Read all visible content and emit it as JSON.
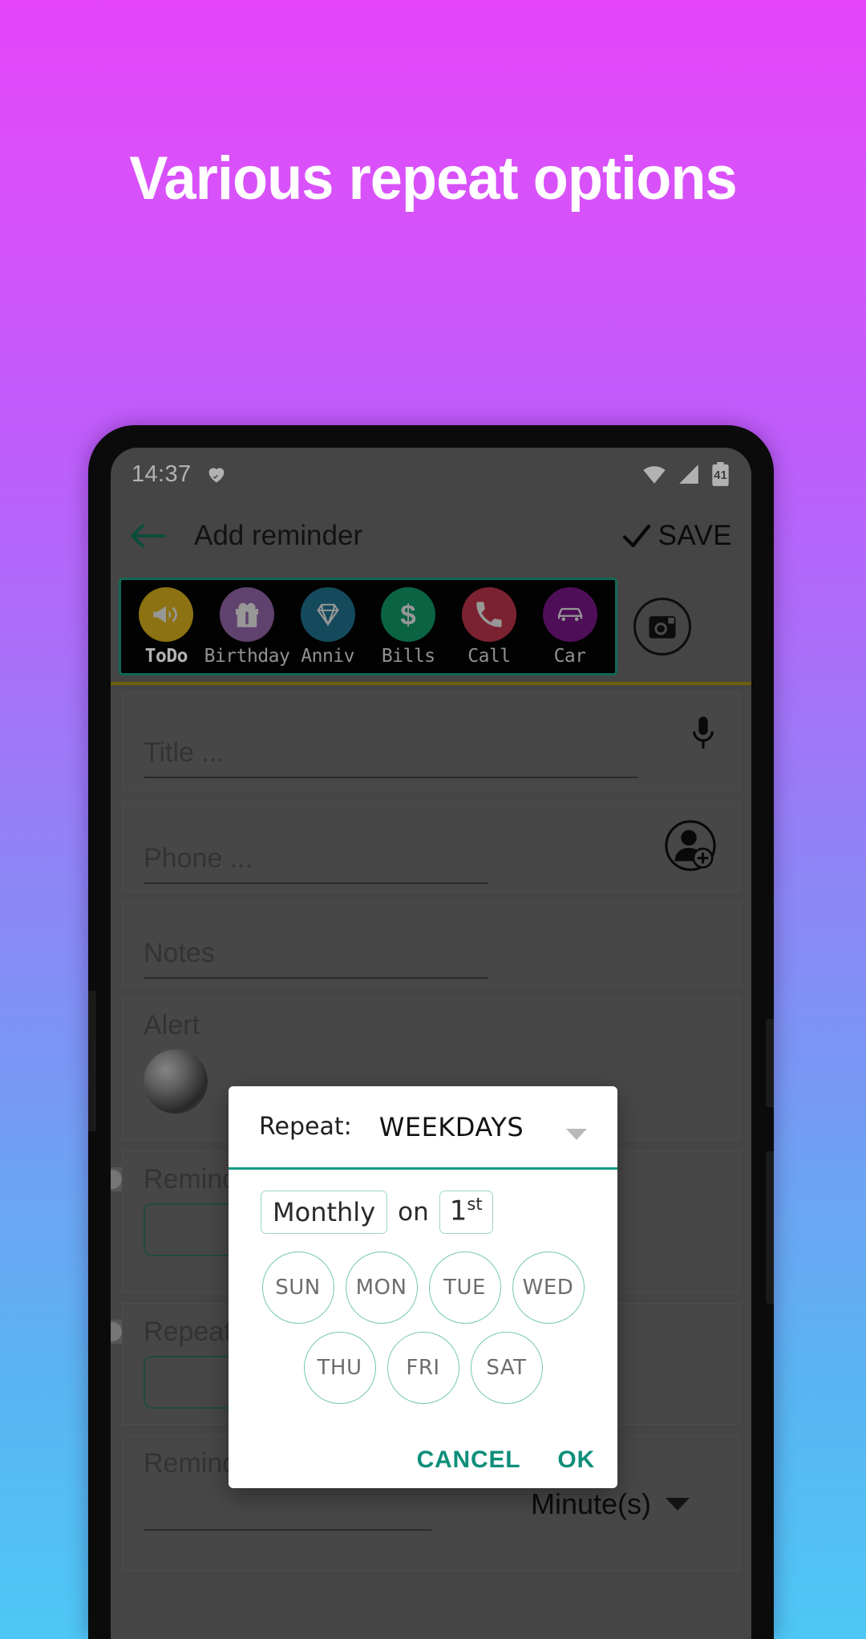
{
  "promo": {
    "headline": "Various repeat options",
    "background_gradient_from": "#e344f8",
    "background_gradient_to": "#4ec7f6"
  },
  "statusbar": {
    "time": "14:37",
    "heart_icon": "heart-check-icon",
    "wifi_icon": "wifi-icon",
    "signal_icon": "cell-signal-icon",
    "battery_icon": "battery-icon",
    "battery_level": "41"
  },
  "appbar": {
    "back_icon": "back-arrow-icon",
    "title": "Add reminder",
    "save_check_icon": "check-icon",
    "save_label": "SAVE",
    "accent_color": "#0f7a63"
  },
  "categories": {
    "camera_icon": "camera-icon",
    "items": [
      {
        "label": "ToDo",
        "icon": "megaphone-icon",
        "color": "#c9a41b",
        "selected": true
      },
      {
        "label": "Birthday",
        "icon": "gift-icon",
        "color": "#8a5f9e",
        "selected": false
      },
      {
        "label": "Anniv",
        "icon": "diamond-icon",
        "color": "#1f6b85",
        "selected": false
      },
      {
        "label": "Bills",
        "icon": "dollar-icon",
        "color": "#0f8e5f",
        "selected": false
      },
      {
        "label": "Call",
        "icon": "phone-icon",
        "color": "#b03246",
        "selected": false
      },
      {
        "label": "Car",
        "icon": "car-icon",
        "color": "#72157f",
        "selected": false
      }
    ]
  },
  "form": {
    "title_placeholder": "Title ...",
    "title_mic_icon": "microphone-icon",
    "phone_placeholder": "Phone ...",
    "phone_contact_icon": "add-contact-icon",
    "notes_placeholder": "Notes",
    "alert_label": "Alert",
    "remind_label": "Remind",
    "repeat_label": "Repeat",
    "remind_before_label": "Remind before",
    "remind_before_unit": "Minute(s)",
    "unit_caret_icon": "chevron-down-icon"
  },
  "dialog": {
    "repeat_label": "Repeat:",
    "repeat_value": "WEEKDAYS",
    "repeat_caret_icon": "chevron-down-icon",
    "monthly_label": "Monthly",
    "on_label": "on",
    "ordinal_number": "1",
    "ordinal_suffix": "st",
    "days_row_1": [
      "SUN",
      "MON",
      "TUE",
      "WED"
    ],
    "days_row_2": [
      "THU",
      "FRI",
      "SAT"
    ],
    "cancel_label": "CANCEL",
    "ok_label": "OK",
    "accent_color": "#0f8f7a"
  }
}
